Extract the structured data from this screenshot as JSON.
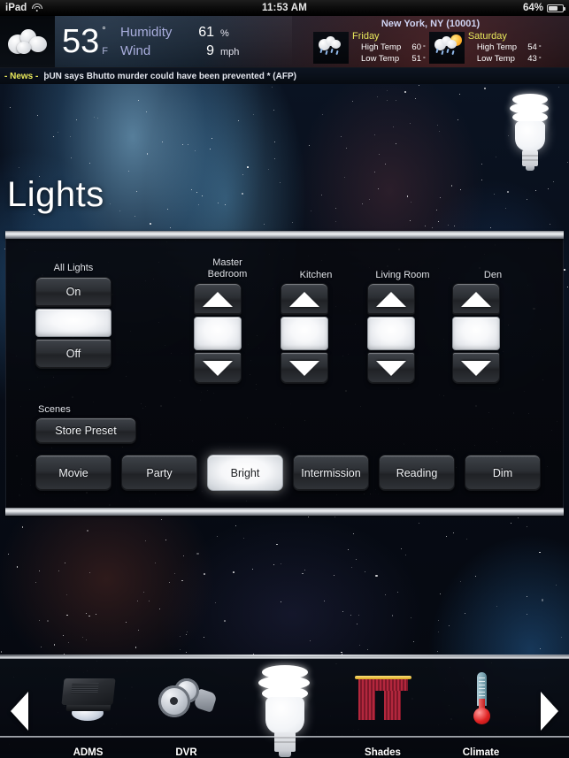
{
  "statusbar": {
    "device": "iPad",
    "wifi_icon": "wifi-icon",
    "time": "11:53 AM",
    "battery_percent": "64%",
    "battery_icon": "battery-icon"
  },
  "weather": {
    "current_icon": "cloudy-icon",
    "temperature": "53",
    "degree_symbol": "°",
    "unit": "F",
    "humidity_label": "Humidity",
    "humidity_value": "61",
    "humidity_unit": "%",
    "wind_label": "Wind",
    "wind_value": "9",
    "wind_unit": "mph",
    "location": "New York, NY (10001)",
    "forecast": [
      {
        "day": "Friday",
        "icon": "rain-cloud-icon",
        "high_label": "High Temp",
        "high_value": "60",
        "low_label": "Low Temp",
        "low_value": "51",
        "degree": "°"
      },
      {
        "day": "Saturday",
        "icon": "sun-rain-cloud-icon",
        "high_label": "High Temp",
        "high_value": "54",
        "low_label": "Low Temp",
        "low_value": "43",
        "degree": "°"
      }
    ]
  },
  "news": {
    "tag": "- News -",
    "headline": "þUN says Bhutto murder could have been prevented * (AFP)"
  },
  "page": {
    "title": "Lights",
    "hero_icon": "light-bulb-icon"
  },
  "controls": {
    "all_lights": {
      "label": "All Lights",
      "on_label": "On",
      "off_label": "Off",
      "indicator_state": "lit"
    },
    "dimmers": [
      {
        "label": "Master\nBedroom",
        "label_line1": "Master",
        "label_line2": "Bedroom",
        "up_icon": "triangle-up-icon",
        "down_icon": "triangle-down-icon"
      },
      {
        "label": "Kitchen",
        "label_line1": "Kitchen",
        "label_line2": "",
        "up_icon": "triangle-up-icon",
        "down_icon": "triangle-down-icon"
      },
      {
        "label": "Living Room",
        "label_line1": "Living Room",
        "label_line2": "",
        "up_icon": "triangle-up-icon",
        "down_icon": "triangle-down-icon"
      },
      {
        "label": "Den",
        "label_line1": "Den",
        "label_line2": "",
        "up_icon": "triangle-up-icon",
        "down_icon": "triangle-down-icon"
      }
    ]
  },
  "scenes": {
    "section_label": "Scenes",
    "store_preset_label": "Store Preset",
    "buttons": [
      {
        "label": "Movie",
        "active": false
      },
      {
        "label": "Party",
        "active": false
      },
      {
        "label": "Bright",
        "active": true
      },
      {
        "label": "Intermission",
        "active": false
      },
      {
        "label": "Reading",
        "active": false
      },
      {
        "label": "Dim",
        "active": false
      }
    ]
  },
  "dock": {
    "prev_icon": "arrow-left-icon",
    "next_icon": "arrow-right-icon",
    "items": [
      {
        "label": "ADMS",
        "icon": "av-receiver-icon"
      },
      {
        "label": "DVR",
        "icon": "film-reel-icon"
      },
      {
        "label": "",
        "icon": "light-bulb-icon"
      },
      {
        "label": "Shades",
        "icon": "curtains-icon"
      },
      {
        "label": "Climate",
        "icon": "thermometer-icon"
      }
    ]
  },
  "colors": {
    "accent_yellow": "#e8e85c",
    "label_blue": "#a9aedd",
    "city_blue": "#cfd3f2",
    "panel_bg": "#080a10",
    "active_button": "#ffffff"
  }
}
